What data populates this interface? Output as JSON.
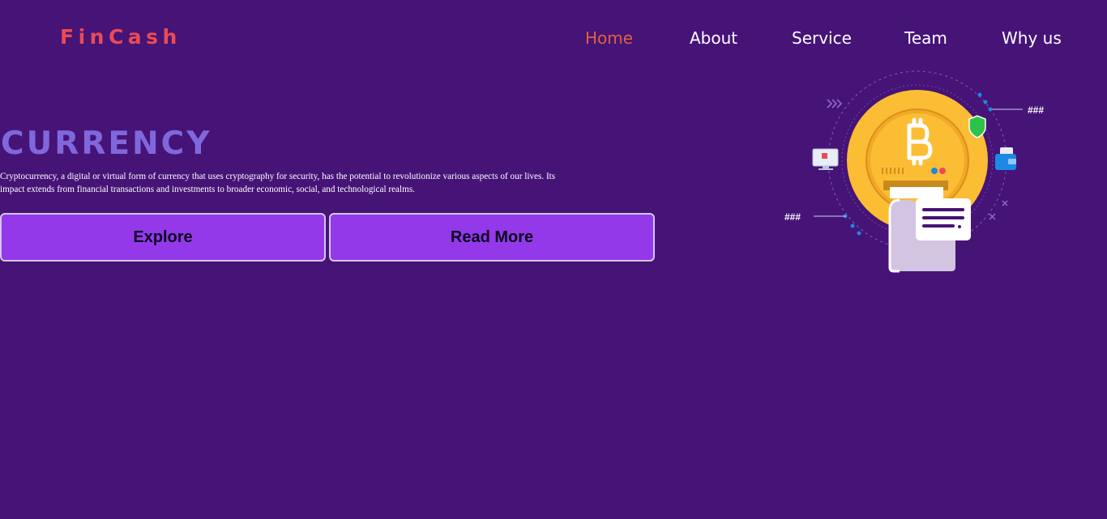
{
  "brand": {
    "logo": "FinCash"
  },
  "nav": {
    "items": [
      {
        "label": "Home",
        "active": true
      },
      {
        "label": "About",
        "active": false
      },
      {
        "label": "Service",
        "active": false
      },
      {
        "label": "Team",
        "active": false
      },
      {
        "label": "Why us",
        "active": false
      }
    ]
  },
  "hero": {
    "title": "CURRENCY",
    "description": "Cryptocurrency, a digital or virtual form of currency that uses cryptography for security, has the potential to revolutionize various aspects of our lives. Its impact extends from financial transactions and investments to broader economic, social, and technological realms.",
    "buttons": {
      "explore": "Explore",
      "read_more": "Read More"
    }
  },
  "illustration": {
    "icon": "bitcoin-coin-illustration",
    "hash_right": "###",
    "hash_left": "###"
  },
  "colors": {
    "background": "#461377",
    "logo": "#ea4b55",
    "nav_active": "#e0603f",
    "title": "#8068dc",
    "button": "#9339ea",
    "coin": "#fbbd33"
  }
}
